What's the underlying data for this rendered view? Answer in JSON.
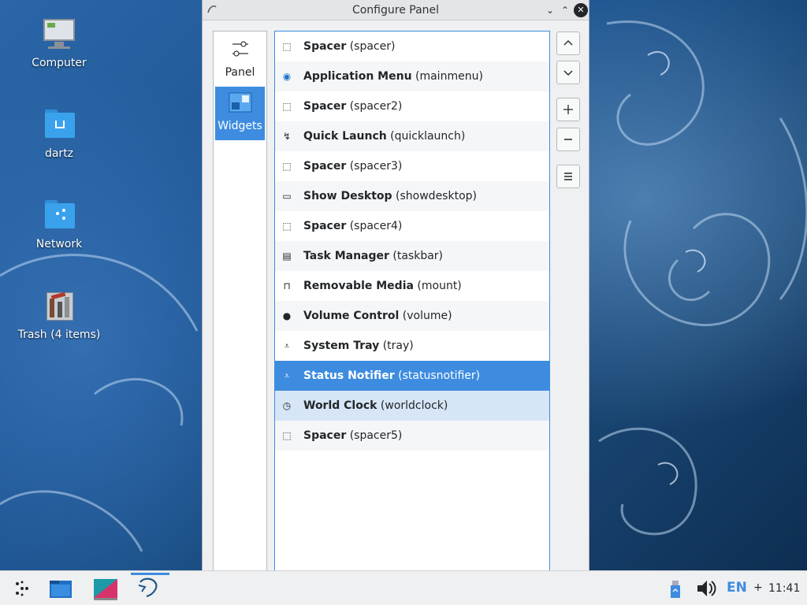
{
  "desktop": {
    "icons": [
      {
        "label": "Computer",
        "icon": "computer-icon"
      },
      {
        "label": "dartz",
        "icon": "home-folder-icon"
      },
      {
        "label": "Network",
        "icon": "network-folder-icon"
      },
      {
        "label": "Trash (4 items)",
        "icon": "trash-icon"
      }
    ]
  },
  "dialog": {
    "title": "Configure Panel",
    "sidebar": [
      {
        "label": "Panel",
        "icon": "panel-settings-icon",
        "selected": false
      },
      {
        "label": "Widgets",
        "icon": "widgets-icon",
        "selected": true
      }
    ],
    "widgets": [
      {
        "name": "Spacer",
        "id": "(spacer)",
        "icon": "spacer-icon",
        "glyph": "⬚"
      },
      {
        "name": "Application Menu",
        "id": "(mainmenu)",
        "icon": "application-menu-icon",
        "glyph": "◉"
      },
      {
        "name": "Spacer",
        "id": "(spacer2)",
        "icon": "spacer-icon",
        "glyph": "⬚"
      },
      {
        "name": "Quick Launch",
        "id": "(quicklaunch)",
        "icon": "quick-launch-icon",
        "glyph": "↯"
      },
      {
        "name": "Spacer",
        "id": "(spacer3)",
        "icon": "spacer-icon",
        "glyph": "⬚"
      },
      {
        "name": "Show Desktop",
        "id": "(showdesktop)",
        "icon": "show-desktop-icon",
        "glyph": "▭"
      },
      {
        "name": "Spacer",
        "id": "(spacer4)",
        "icon": "spacer-icon",
        "glyph": "⬚"
      },
      {
        "name": "Task Manager",
        "id": "(taskbar)",
        "icon": "task-manager-icon",
        "glyph": "▤"
      },
      {
        "name": "Removable Media",
        "id": "(mount)",
        "icon": "removable-media-icon",
        "glyph": "⊓"
      },
      {
        "name": "Volume Control",
        "id": "(volume)",
        "icon": "volume-control-icon",
        "glyph": "●"
      },
      {
        "name": "System Tray",
        "id": "(tray)",
        "icon": "system-tray-icon",
        "glyph": "⩡"
      },
      {
        "name": "Status Notifier",
        "id": "(statusnotifier)",
        "icon": "status-notifier-icon",
        "glyph": "⩡"
      },
      {
        "name": "World Clock",
        "id": "(worldclock)",
        "icon": "world-clock-icon",
        "glyph": "◷"
      },
      {
        "name": "Spacer",
        "id": "(spacer5)",
        "icon": "spacer-icon",
        "glyph": "⬚"
      }
    ],
    "selected_index": 11,
    "hover_index": 12,
    "buttons": [
      {
        "name": "move-up-button",
        "glyph": "⌃"
      },
      {
        "name": "move-down-button",
        "glyph": "⌄"
      },
      {
        "name": "add-widget-button",
        "glyph": "+"
      },
      {
        "name": "remove-widget-button",
        "glyph": "−"
      },
      {
        "name": "widget-menu-button",
        "glyph": "≡"
      }
    ]
  },
  "taskbar": {
    "lang": "EN",
    "plus": "+",
    "clock": "11:41"
  },
  "colors": {
    "accent": "#3d8ce0",
    "dialog_bg": "#eff0f1"
  }
}
